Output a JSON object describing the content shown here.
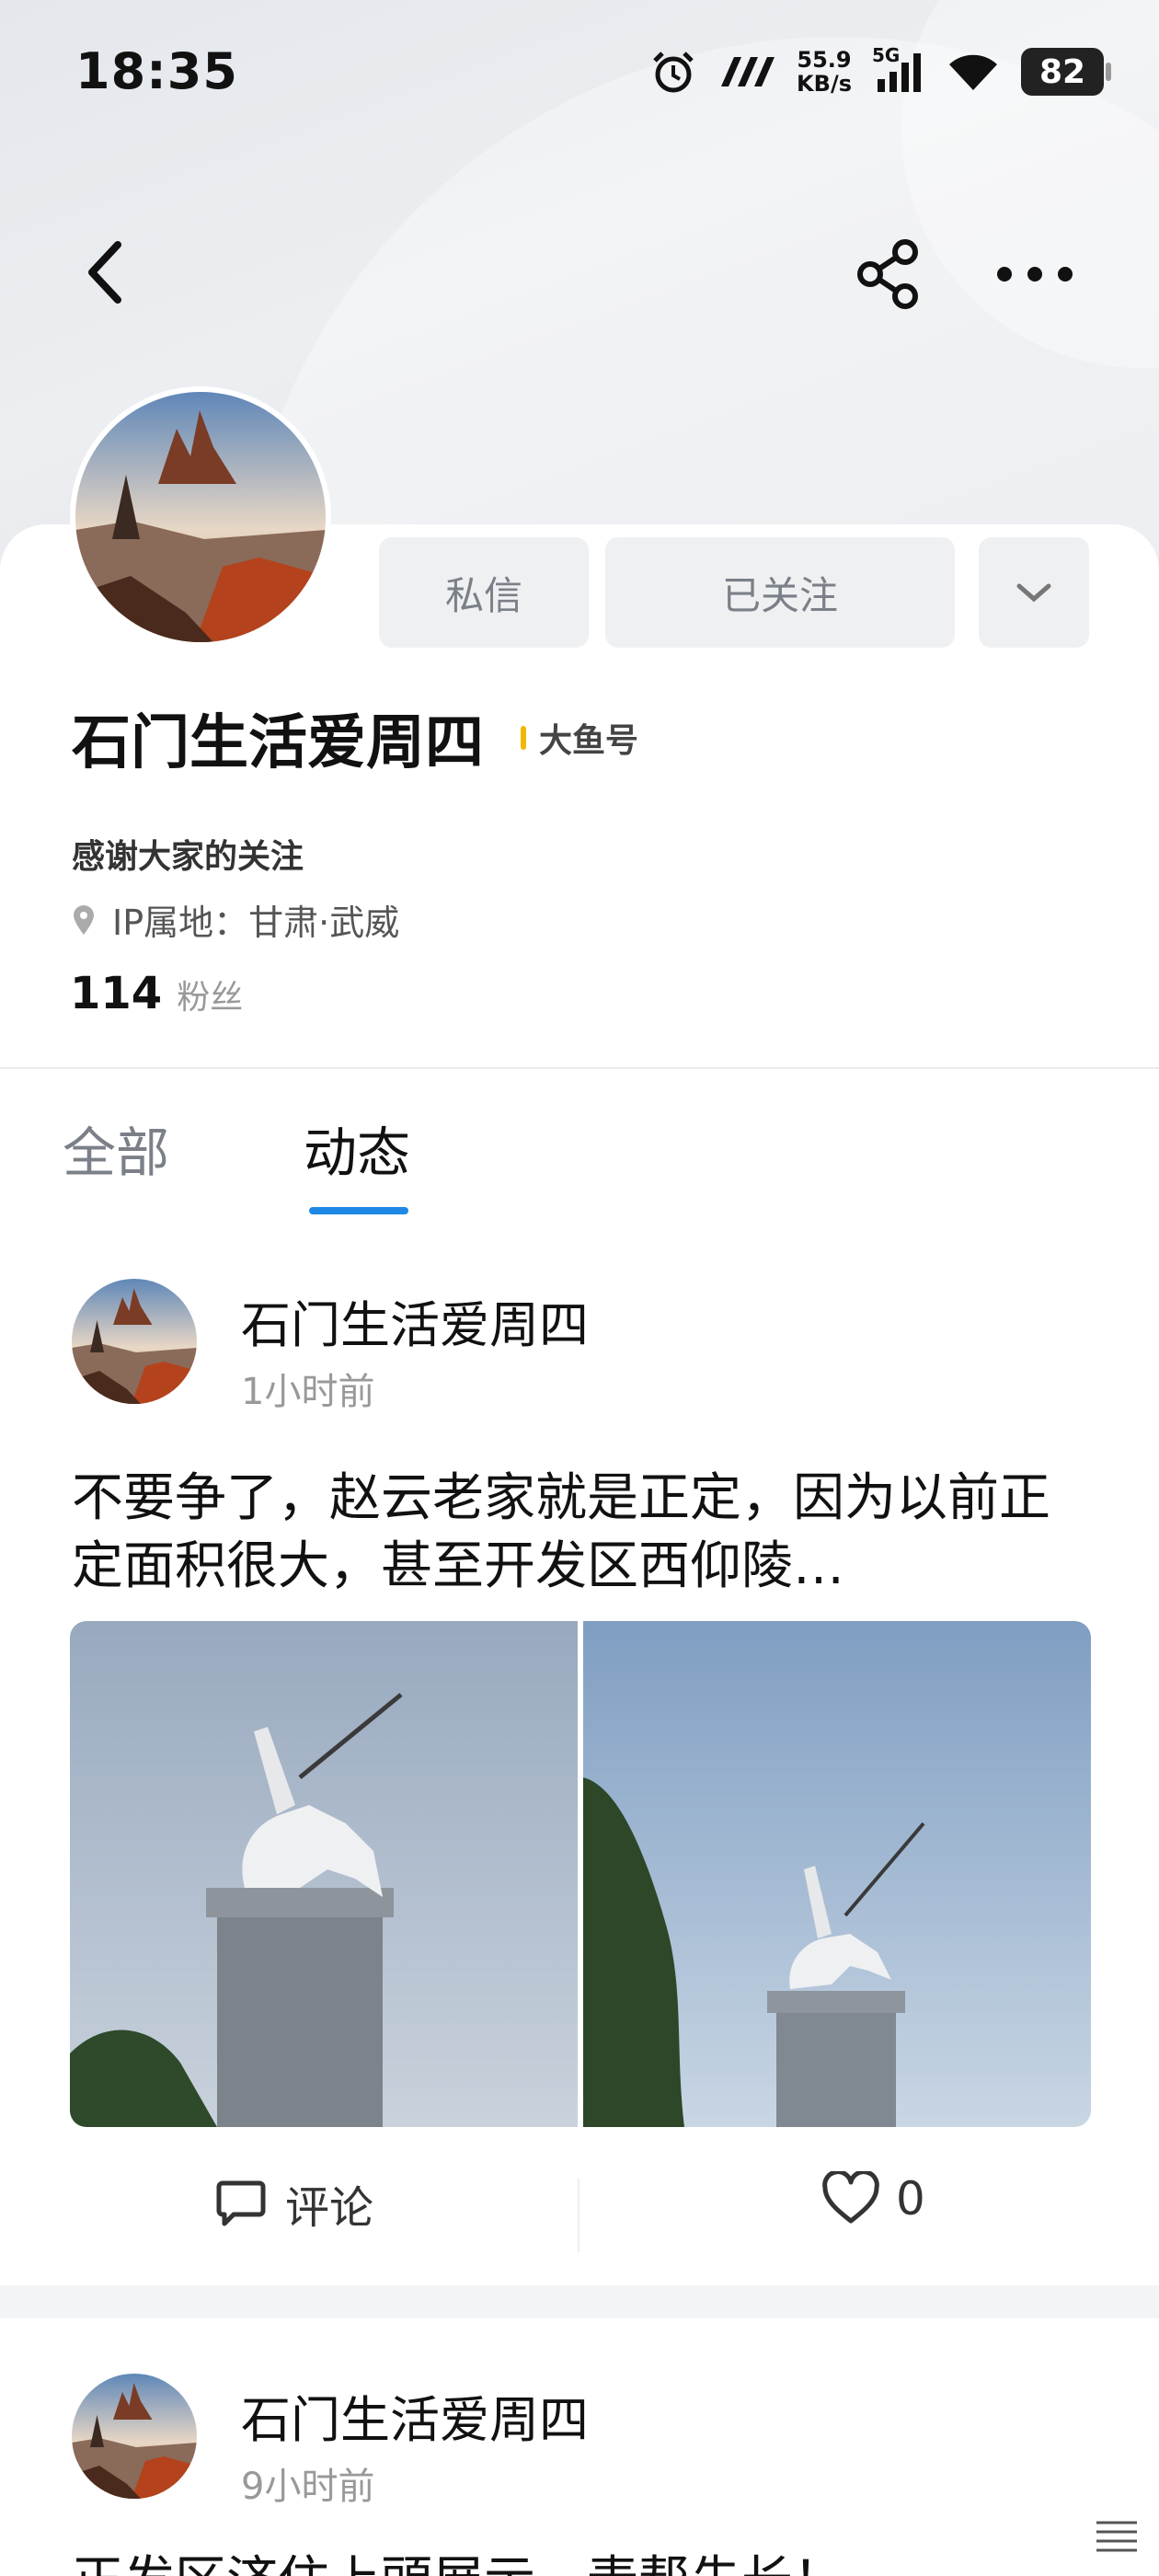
{
  "status_bar": {
    "time": "18:35",
    "net_speed_value": "55.9",
    "net_speed_unit": "KB/s",
    "network": "5G",
    "battery": "82"
  },
  "nav": {
    "back_icon": "chevron-left-icon",
    "share_icon": "share-icon",
    "more_icon": "more-icon"
  },
  "profile": {
    "name": "石门生活爱周四",
    "badge": "大鱼号",
    "bio": "感谢大家的关注",
    "ip_location": "IP属地：甘肃·武威",
    "fans_count": "114",
    "fans_label": "粉丝",
    "message_button": "私信",
    "follow_button": "已关注"
  },
  "tabs": [
    {
      "label": "全部",
      "active": false
    },
    {
      "label": "动态",
      "active": true
    }
  ],
  "posts": [
    {
      "author": "石门生活爱周四",
      "time": "1小时前",
      "text": "不要争了，赵云老家就是正定，因为以前正定面积很大，甚至开发区西仰陵…",
      "comment_label": "评论",
      "likes": "0"
    },
    {
      "author": "石门生活爱周四",
      "time": "9小时前",
      "text": "正发区济住上頭展示，麦帮先长！"
    }
  ],
  "colors": {
    "accent": "#1e88e5",
    "badge_bar": "#f2b705",
    "button_bg": "#eef0f2"
  }
}
